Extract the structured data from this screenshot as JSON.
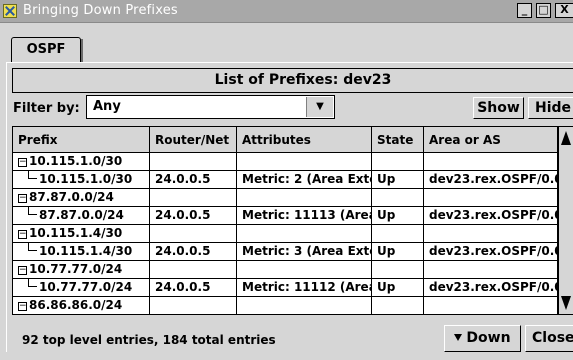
{
  "window": {
    "title": "Bringing Down Prefixes",
    "minimize": "_",
    "maximize": "□",
    "close": "X"
  },
  "tabs": [
    {
      "label": "OSPF",
      "active": true
    }
  ],
  "list_heading": "List of Prefixes: dev23",
  "filter": {
    "label": "Filter by:",
    "selected": "Any",
    "arrow": "▼"
  },
  "buttons": {
    "show": "Show",
    "hide": "Hide",
    "down": "Down",
    "close": "Close"
  },
  "table": {
    "columns": [
      "Prefix",
      "Router/Net",
      "Attributes",
      "State",
      "Area or AS"
    ],
    "rows": [
      {
        "kind": "parent",
        "selected": true,
        "prefix": "10.115.1.0/30",
        "router": "",
        "attributes": "",
        "state": "",
        "area": ""
      },
      {
        "kind": "child",
        "prefix": "10.115.1.0/30",
        "router": "24.0.0.5",
        "attributes": "Metric: 2 (Area Exte",
        "state": "Up",
        "area": "dev23.rex.OSPF/0.0"
      },
      {
        "kind": "parent",
        "prefix": "87.87.0.0/24",
        "router": "",
        "attributes": "",
        "state": "",
        "area": ""
      },
      {
        "kind": "child",
        "prefix": "87.87.0.0/24",
        "router": "24.0.0.5",
        "attributes": "Metric: 11113 (Area",
        "state": "Up",
        "area": "dev23.rex.OSPF/0.0"
      },
      {
        "kind": "parent",
        "prefix": "10.115.1.4/30",
        "router": "",
        "attributes": "",
        "state": "",
        "area": ""
      },
      {
        "kind": "child",
        "prefix": "10.115.1.4/30",
        "router": "24.0.0.5",
        "attributes": "Metric: 3 (Area Exte",
        "state": "Up",
        "area": "dev23.rex.OSPF/0.0"
      },
      {
        "kind": "parent",
        "prefix": "10.77.77.0/24",
        "router": "",
        "attributes": "",
        "state": "",
        "area": ""
      },
      {
        "kind": "child",
        "prefix": "10.77.77.0/24",
        "router": "24.0.0.5",
        "attributes": "Metric: 11112 (Area",
        "state": "Up",
        "area": "dev23.rex.OSPF/0.0"
      },
      {
        "kind": "parent",
        "prefix": "86.86.86.0/24",
        "router": "",
        "attributes": "",
        "state": "",
        "area": ""
      }
    ]
  },
  "status": {
    "entries_text": "92 top level entries, 184 total entries"
  },
  "icons": {
    "app": "app-icon",
    "tree_collapse": "minus-box-icon",
    "tree_branch": "tree-elbow-icon",
    "dropdown": "chevron-down-icon",
    "down": "arrow-down-icon"
  },
  "colors": {
    "titlebar": "#a8a8a8",
    "window_bg": "#d6d6d6",
    "selected_row": "#c8ecfc"
  }
}
